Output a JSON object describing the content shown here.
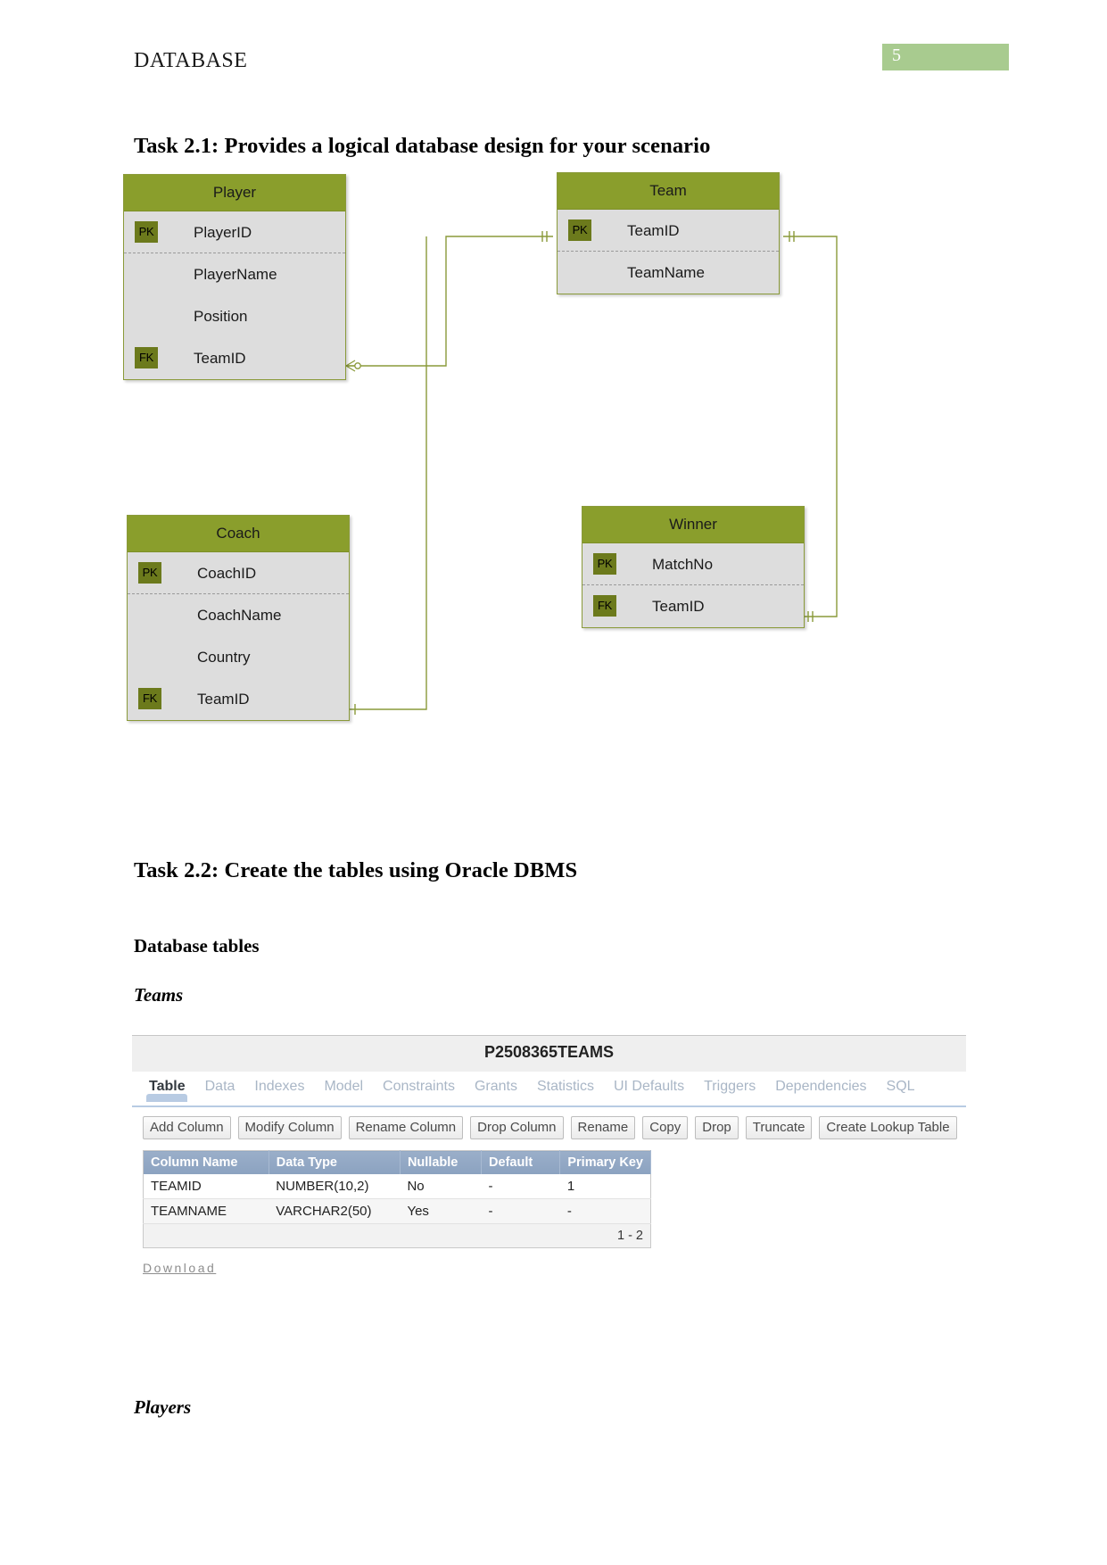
{
  "header": {
    "doc_title": "DATABASE",
    "page_number": "5"
  },
  "headings": {
    "task21": "Task 2.1: Provides a logical database design for your scenario",
    "task22": "Task 2.2: Create the tables using Oracle DBMS",
    "database_tables": "Database tables",
    "teams": "Teams",
    "players": "Players"
  },
  "er_diagram": {
    "colors": {
      "header_green": "#8a9e2c",
      "body_gray": "#dddddd",
      "border_green": "#8a9a3a",
      "key_badge": "#6c7a1c",
      "connector": "#8a9a3a"
    },
    "entities": [
      {
        "name": "Player",
        "attributes": [
          {
            "key": "PK",
            "label": "PlayerID"
          },
          {
            "key": "",
            "label": "PlayerName"
          },
          {
            "key": "",
            "label": "Position"
          },
          {
            "key": "FK",
            "label": "TeamID"
          }
        ]
      },
      {
        "name": "Team",
        "attributes": [
          {
            "key": "PK",
            "label": "TeamID"
          },
          {
            "key": "",
            "label": "TeamName"
          }
        ]
      },
      {
        "name": "Coach",
        "attributes": [
          {
            "key": "PK",
            "label": "CoachID"
          },
          {
            "key": "",
            "label": "CoachName"
          },
          {
            "key": "",
            "label": "Country"
          },
          {
            "key": "FK",
            "label": "TeamID"
          }
        ]
      },
      {
        "name": "Winner",
        "attributes": [
          {
            "key": "PK",
            "label": "MatchNo"
          },
          {
            "key": "FK",
            "label": "TeamID"
          }
        ]
      }
    ],
    "relationships": [
      {
        "from": "Player.TeamID",
        "to": "Team.TeamID",
        "from_card": "crows-foot",
        "to_card": "one-one"
      },
      {
        "from": "Coach.TeamID",
        "to": "Team.TeamID",
        "from_card": "one",
        "to_card": "one-one"
      },
      {
        "from": "Winner.TeamID",
        "to": "Team.TeamID",
        "from_card": "one-one",
        "to_card": "one-one"
      }
    ]
  },
  "apex": {
    "title": "P2508365TEAMS",
    "tabs": [
      {
        "label": "Table",
        "active": true
      },
      {
        "label": "Data",
        "active": false
      },
      {
        "label": "Indexes",
        "active": false
      },
      {
        "label": "Model",
        "active": false
      },
      {
        "label": "Constraints",
        "active": false
      },
      {
        "label": "Grants",
        "active": false
      },
      {
        "label": "Statistics",
        "active": false
      },
      {
        "label": "UI Defaults",
        "active": false
      },
      {
        "label": "Triggers",
        "active": false
      },
      {
        "label": "Dependencies",
        "active": false
      },
      {
        "label": "SQL",
        "active": false
      }
    ],
    "buttons": [
      "Add Column",
      "Modify Column",
      "Rename Column",
      "Drop Column",
      "Rename",
      "Copy",
      "Drop",
      "Truncate",
      "Create Lookup Table"
    ],
    "grid": {
      "columns": [
        "Column Name",
        "Data Type",
        "Nullable",
        "Default",
        "Primary Key"
      ],
      "rows": [
        [
          "TEAMID",
          "NUMBER(10,2)",
          "No",
          "-",
          "1"
        ],
        [
          "TEAMNAME",
          "VARCHAR2(50)",
          "Yes",
          "-",
          "-"
        ]
      ],
      "pagination": "1 - 2"
    },
    "download_label": "Download"
  }
}
